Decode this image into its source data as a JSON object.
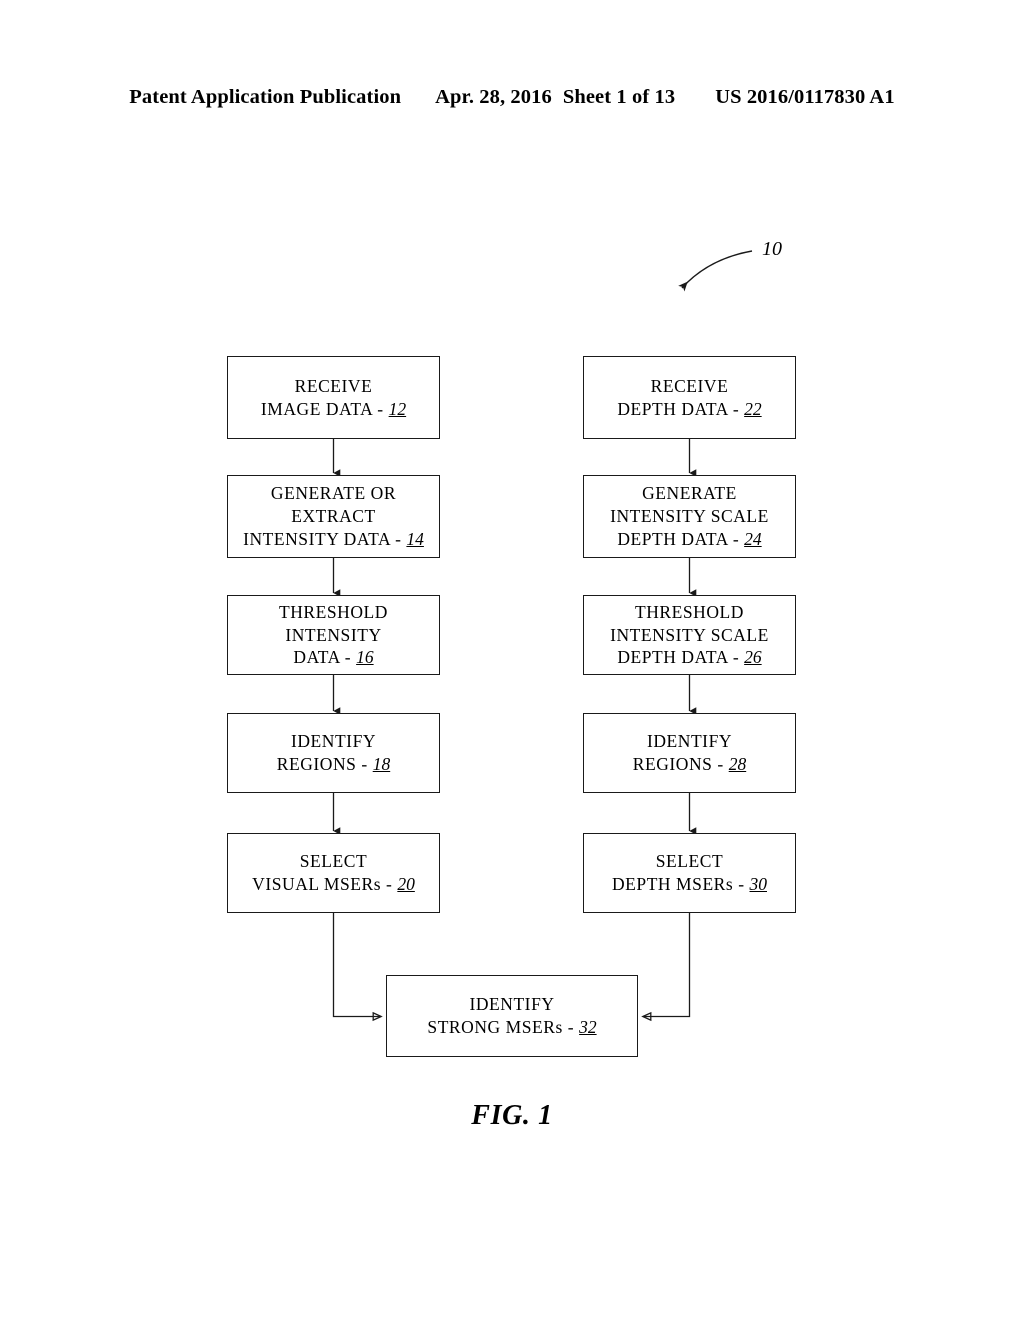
{
  "header": {
    "publication": "Patent Application Publication",
    "date": "Apr. 28, 2016",
    "sheet": "Sheet 1 of 13",
    "patent_number": "US 2016/0117830 A1"
  },
  "figure": {
    "caption": "FIG. 1",
    "callout_label": "10",
    "boxes": [
      {
        "id": "box-12",
        "ref": "12",
        "lines": [
          "RECEIVE",
          "IMAGE DATA - "
        ],
        "column": "left",
        "order": 1
      },
      {
        "id": "box-14",
        "ref": "14",
        "lines": [
          "GENERATE OR",
          "EXTRACT",
          "INTENSITY DATA - "
        ],
        "column": "left",
        "order": 2
      },
      {
        "id": "box-16",
        "ref": "16",
        "lines": [
          "THRESHOLD",
          "INTENSITY",
          "DATA - "
        ],
        "column": "left",
        "order": 3
      },
      {
        "id": "box-18",
        "ref": "18",
        "lines": [
          "IDENTIFY",
          "REGIONS - "
        ],
        "column": "left",
        "order": 4
      },
      {
        "id": "box-20",
        "ref": "20",
        "lines": [
          "SELECT",
          "VISUAL MSERs - "
        ],
        "column": "left",
        "order": 5
      },
      {
        "id": "box-22",
        "ref": "22",
        "lines": [
          "RECEIVE",
          "DEPTH DATA - "
        ],
        "column": "right",
        "order": 1
      },
      {
        "id": "box-24",
        "ref": "24",
        "lines": [
          "GENERATE",
          "INTENSITY SCALE",
          "DEPTH DATA - "
        ],
        "column": "right",
        "order": 2
      },
      {
        "id": "box-26",
        "ref": "26",
        "lines": [
          "THRESHOLD",
          "INTENSITY SCALE",
          "DEPTH DATA - "
        ],
        "column": "right",
        "order": 3
      },
      {
        "id": "box-28",
        "ref": "28",
        "lines": [
          "IDENTIFY",
          "REGIONS - "
        ],
        "column": "right",
        "order": 4
      },
      {
        "id": "box-30",
        "ref": "30",
        "lines": [
          "SELECT",
          "DEPTH MSERs - "
        ],
        "column": "right",
        "order": 5
      },
      {
        "id": "box-32",
        "ref": "32",
        "lines": [
          "IDENTIFY",
          "STRONG MSERs - "
        ],
        "column": "merge",
        "order": 6
      }
    ]
  },
  "colors": {
    "ink": "#1a1a1a",
    "paper": "#ffffff"
  }
}
